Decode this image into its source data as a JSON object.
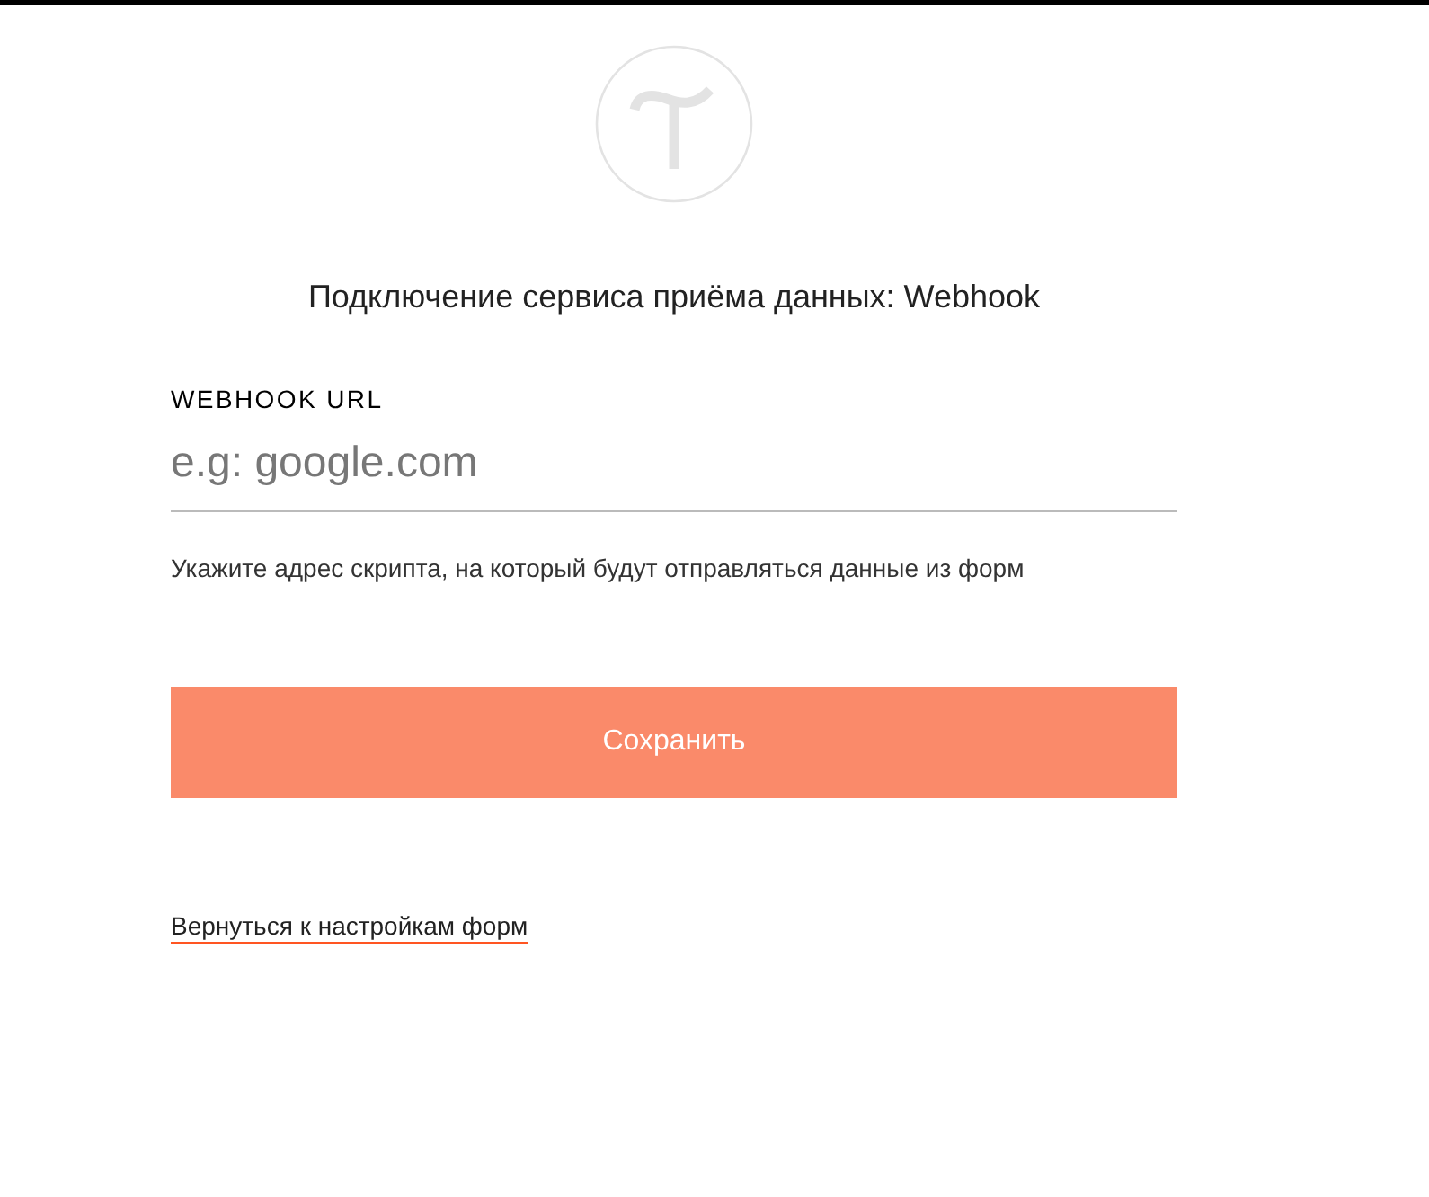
{
  "title": "Подключение сервиса приёма данных: Webhook",
  "field": {
    "label": "WEBHOOK URL",
    "placeholder": "e.g: google.com",
    "hint": "Укажите адрес скрипта, на который будут отправляться данные из форм"
  },
  "save_button": "Сохранить",
  "back_link": "Вернуться к настройкам форм"
}
